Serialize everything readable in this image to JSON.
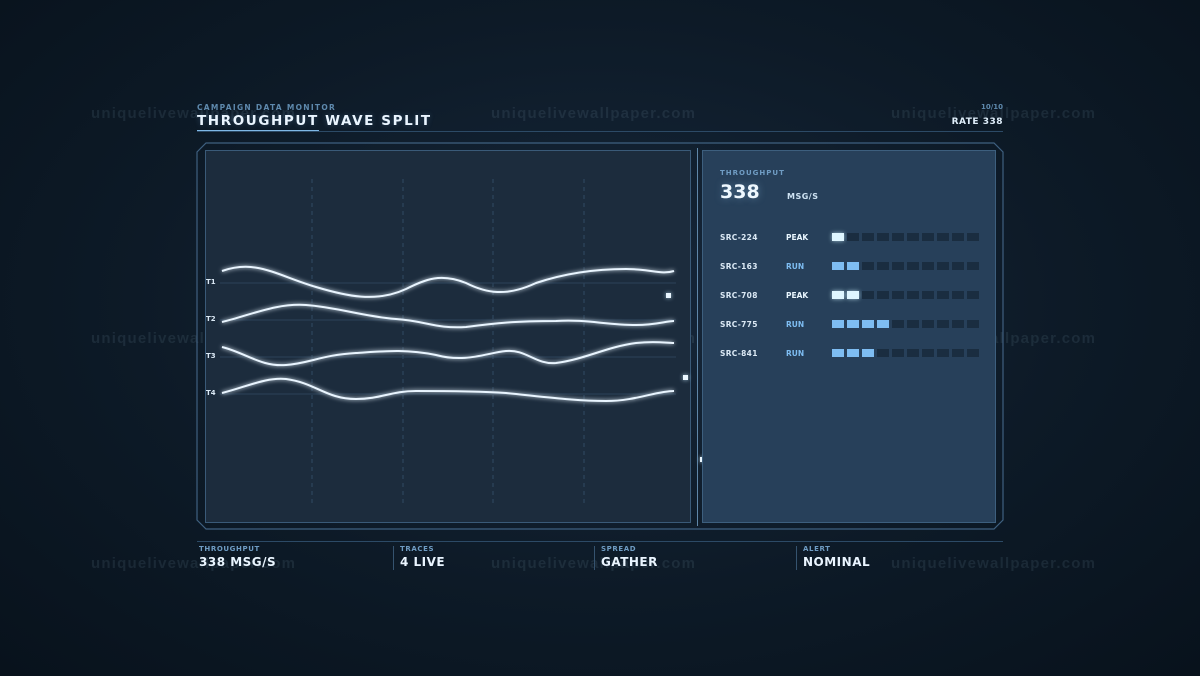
{
  "watermark": "uniquelivewallpaper.com",
  "header": {
    "kicker": "CAMPAIGN DATA MONITOR",
    "title": "THROUGHPUT WAVE SPLIT",
    "page": "10/10",
    "rate": "RATE 338"
  },
  "traces": {
    "labels": [
      "T1",
      "T2",
      "T3",
      "T4"
    ]
  },
  "metric": {
    "label": "THROUGHPUT",
    "value": "338",
    "unit": "MSG/S"
  },
  "sources": [
    {
      "name": "SRC-224",
      "status": "PEAK",
      "level": 1
    },
    {
      "name": "SRC-163",
      "status": "RUN",
      "level": 2
    },
    {
      "name": "SRC-708",
      "status": "PEAK",
      "level": 2
    },
    {
      "name": "SRC-775",
      "status": "RUN",
      "level": 4
    },
    {
      "name": "SRC-841",
      "status": "RUN",
      "level": 3
    }
  ],
  "meter_segments": 10,
  "footer": [
    {
      "label": "THROUGHPUT",
      "value": "338 MSG/S"
    },
    {
      "label": "TRACES",
      "value": "4 LIVE"
    },
    {
      "label": "SPREAD",
      "value": "GATHER"
    },
    {
      "label": "ALERT",
      "value": "NOMINAL"
    }
  ],
  "colors": {
    "accent": "#7fb8e6",
    "run": "#7ebdf2",
    "peak": "#dff6ff",
    "status_run": "#7ebdf2",
    "status_peak": "#eaf7ff"
  }
}
